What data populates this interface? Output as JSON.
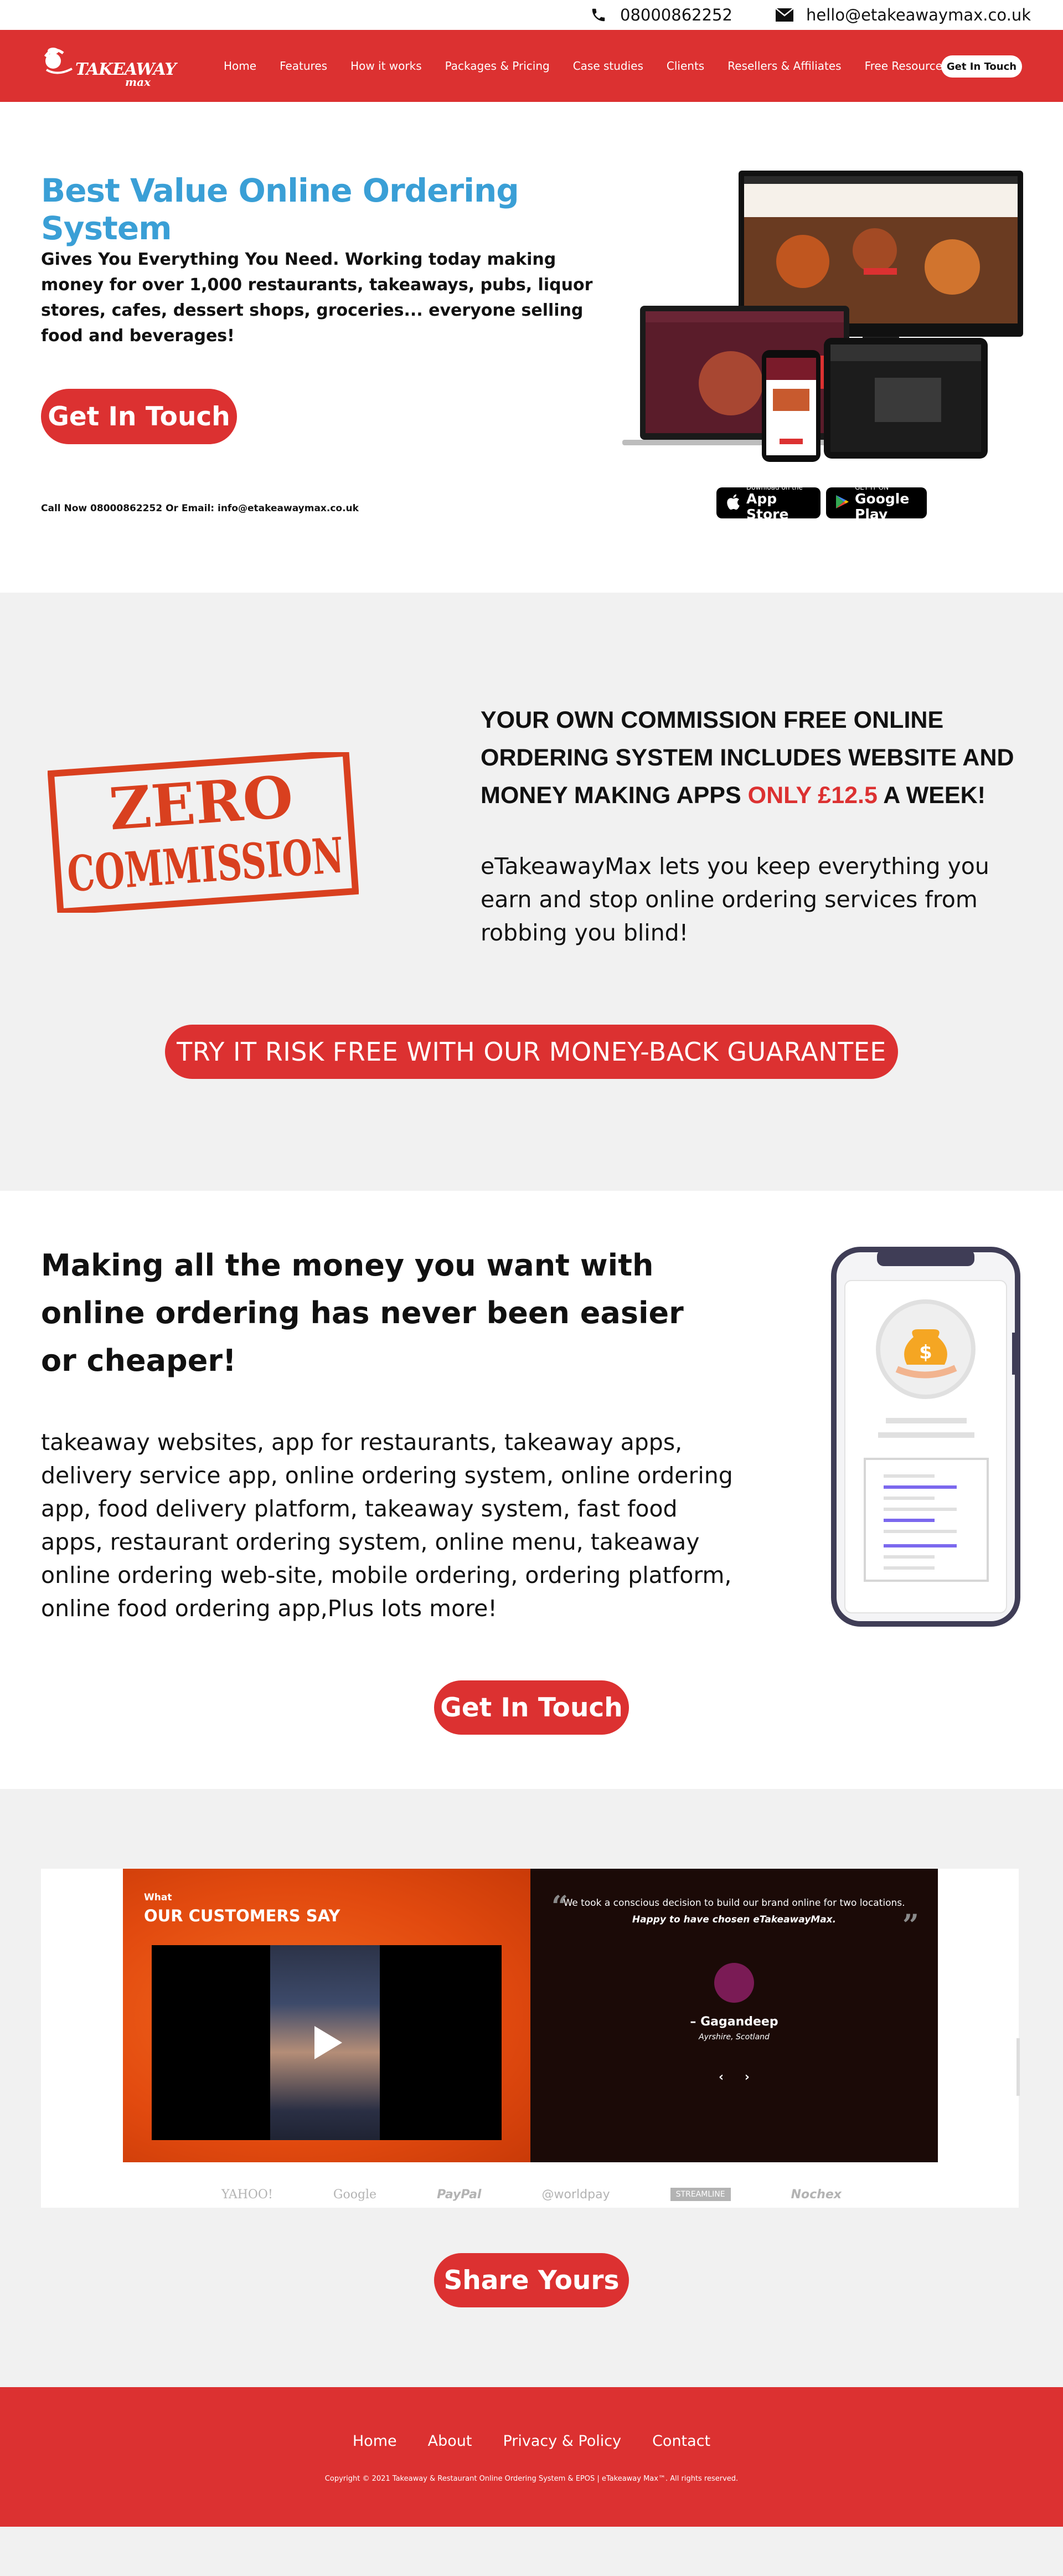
{
  "topbar": {
    "phone": "08000862252",
    "email": "hello@etakeawaymax.co.uk"
  },
  "brand": {
    "logo_word": "TAKEAWAY",
    "logo_sub": "max",
    "red": "#dc3131",
    "blue": "#3a9fd6"
  },
  "nav": {
    "items": [
      {
        "label": "Home"
      },
      {
        "label": "Features"
      },
      {
        "label": "How it works"
      },
      {
        "label": "Packages & Pricing"
      },
      {
        "label": "Case studies"
      },
      {
        "label": "Clients"
      },
      {
        "label": "Resellers & Affiliates"
      },
      {
        "label": "Free Resources"
      }
    ],
    "cta": "Get In Touch"
  },
  "hero": {
    "title": "Best Value Online Ordering System",
    "lead": "Gives You Everything You Need. Working today making money for over 1,000 restaurants, takeaways, pubs, liquor stores, cafes, dessert shops, groceries... everyone selling food and beverages!",
    "cta": "Get In Touch",
    "callnow": "Call Now 08000862252 Or Email: info@etakeawaymax.co.uk",
    "badges": {
      "apple_small": "Download on the",
      "apple_big": "App Store",
      "google_small": "GET IT ON",
      "google_big": "Google Play"
    }
  },
  "zero": {
    "stamp_line1": "ZERO",
    "stamp_line2": "COMMISSION",
    "heading_main": "YOUR OWN COMMISSION FREE ONLINE ORDERING SYSTEM INCLUDES WEBSITE AND MONEY MAKING APPS",
    "heading_accent": "ONLY £12.5",
    "heading_end": "A WEEK!",
    "paragraph": "eTakeawayMax lets you keep everything you earn and stop online ordering services from robbing you blind!",
    "guarantee": "TRY IT RISK FREE WITH OUR MONEY-BACK GUARANTEE"
  },
  "money": {
    "heading": "Making all the money you want with online ordering has never been easier or cheaper!",
    "keywords": "takeaway websites, app for restaurants, takeaway apps, delivery service app, online ordering system, online ordering app, food delivery platform, takeaway system, fast food apps, restaurant ordering system, online menu, takeaway online ordering web-site, mobile ordering, ordering platform, online food ordering app,Plus lots more!",
    "cta": "Get In Touch"
  },
  "testimonials": {
    "what": "What",
    "title": "OUR CUSTOMERS SAY",
    "quote": "We took a conscious decision to build our brand online for two locations.",
    "quote_emphasis": "Happy to have chosen eTakeawayMax.",
    "name": "– Gagandeep",
    "place": "Ayrshire, Scotland",
    "prev": "‹",
    "next": "›",
    "logos": [
      "YAHOO!",
      "Google",
      "PayPal",
      "@worldpay",
      "STREAMLINE",
      "Nochex"
    ],
    "share": "Share Yours"
  },
  "footer": {
    "links": [
      {
        "label": "Home"
      },
      {
        "label": "About"
      },
      {
        "label": "Privacy & Policy"
      },
      {
        "label": "Contact"
      }
    ],
    "copyright": "Copyright © 2021 Takeaway & Restaurant Online Ordering System & EPOS | eTakeaway Max™. All rights reserved."
  }
}
